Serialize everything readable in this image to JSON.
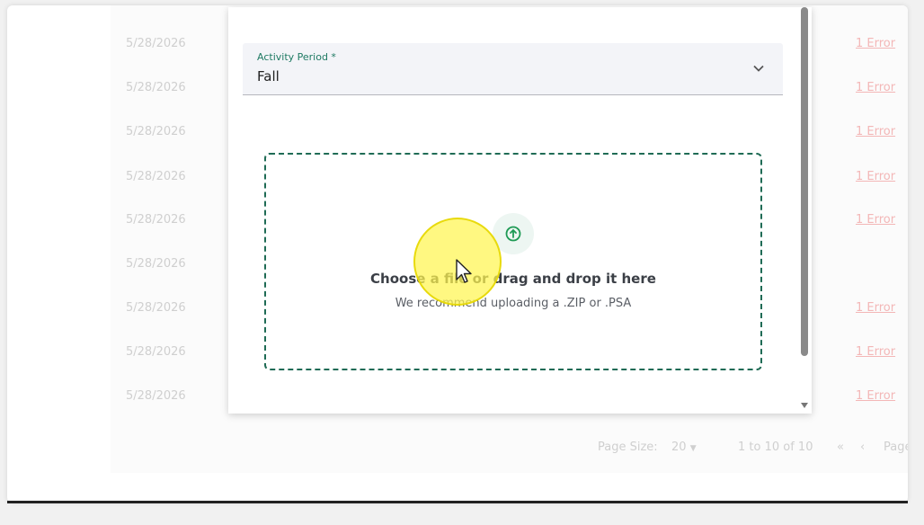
{
  "background_table": {
    "rows": [
      {
        "date": "5/28/2026",
        "errors": "1 Error"
      },
      {
        "date": "5/28/2026",
        "errors": "1 Error"
      },
      {
        "date": "5/28/2026",
        "errors": "1 Error"
      },
      {
        "date": "5/28/2026",
        "errors": "1 Error"
      },
      {
        "date": "5/28/2026",
        "errors": "1 Error"
      },
      {
        "date": "5/28/2026",
        "errors": ""
      },
      {
        "date": "5/28/2026",
        "errors": "1 Error"
      },
      {
        "date": "5/28/2026",
        "errors": "1 Error"
      },
      {
        "date": "5/28/2026",
        "errors": "1 Error"
      }
    ],
    "pager": {
      "page_size_label": "Page Size:",
      "page_size_value": "20",
      "range_text": "1 to 10 of 10",
      "page_label": "Page"
    }
  },
  "dialog": {
    "activity_period": {
      "label": "Activity Period *",
      "value": "Fall"
    },
    "dropzone": {
      "icon": "upload-icon",
      "title": "Choose a file or drag and drop it here",
      "subtitle": "We recommend uploading a .ZIP or .PSA"
    }
  },
  "colors": {
    "accent": "#1f7a63",
    "error_link": "#f3b7b7",
    "dropzone_border": "#1f6b55"
  }
}
